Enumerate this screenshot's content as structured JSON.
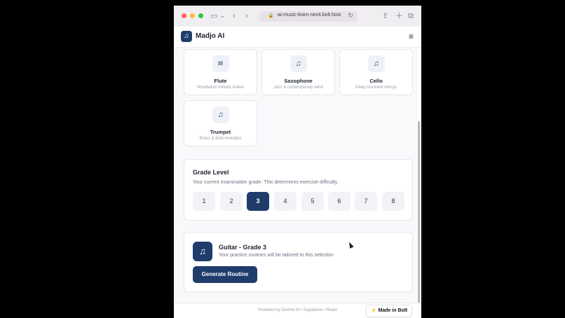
{
  "browser": {
    "url": "-ai-music-learn-nez4.bolt.host",
    "traffic_colors": [
      "#ff5f57",
      "#febc2e",
      "#28c840"
    ]
  },
  "app": {
    "brand": "Madjo AI",
    "logo_icon": "music-note-icon",
    "menu_icon": "hamburger-menu-icon"
  },
  "instruments": [
    {
      "name": "Flute",
      "desc": "Woodwind melody maker",
      "icon": "wind-icon"
    },
    {
      "name": "Saxophone",
      "desc": "Jazz & contemporary wind",
      "icon": "music-note-icon"
    },
    {
      "name": "Cello",
      "desc": "Deep resonant strings",
      "icon": "music-note-icon"
    },
    {
      "name": "Trumpet",
      "desc": "Brass & bold melodies",
      "icon": "music-note-icon"
    }
  ],
  "grade": {
    "title": "Grade Level",
    "subtitle": "Your current examination grade. This determines exercise difficulty.",
    "options": [
      "1",
      "2",
      "3",
      "4",
      "5",
      "6",
      "7",
      "8"
    ],
    "selected": "3"
  },
  "selection": {
    "title": "Guitar - Grade 3",
    "subtitle": "Your practice routines will be tailored to this selection",
    "button": "Generate Routine",
    "icon": "music-note-icon"
  },
  "footer": {
    "text": "Powered by Gemini AI • Supabase • React",
    "badge": "Made in Bolt"
  },
  "colors": {
    "primary": "#1f3c6b",
    "background": "#f8f9fb"
  }
}
